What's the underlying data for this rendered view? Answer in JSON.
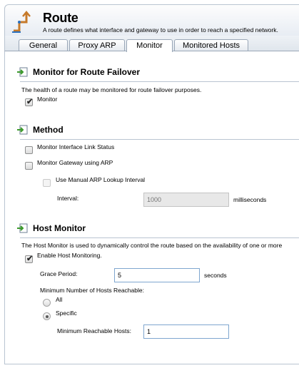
{
  "header": {
    "title": "Route",
    "subtitle": "A route defines what interface and gateway to use in order to reach a specified network."
  },
  "tabs": [
    {
      "label": "General"
    },
    {
      "label": "Proxy ARP"
    },
    {
      "label": "Monitor",
      "active": true
    },
    {
      "label": "Monitored Hosts"
    }
  ],
  "sections": {
    "failover": {
      "title": "Monitor for Route Failover",
      "description": "The health of a route may be monitored for route failover purposes.",
      "monitor_label": "Monitor",
      "monitor_checked": true
    },
    "method": {
      "title": "Method",
      "link_status_label": "Monitor Interface Link Status",
      "link_status_checked": false,
      "gateway_arp_label": "Monitor Gateway using ARP",
      "gateway_arp_checked": false,
      "manual_arp_label": "Use Manual ARP Lookup Interval",
      "manual_arp_checked": false,
      "interval_label": "Interval:",
      "interval_value": "1000",
      "interval_unit": "milliseconds"
    },
    "host_monitor": {
      "title": "Host Monitor",
      "description": "The Host Monitor is used to dynamically control the route based on the availability of one or more",
      "enable_label": "Enable Host Monitoring.",
      "enable_checked": true,
      "grace_label": "Grace Period:",
      "grace_value": "5",
      "grace_unit": "seconds",
      "min_hosts_label": "Minimum Number of Hosts Reachable:",
      "option_all": "All",
      "option_specific": "Specific",
      "selected_option": "Specific",
      "min_reachable_label": "Minimum Reachable Hosts:",
      "min_reachable_value": "1"
    }
  },
  "colors": {
    "section_icon_green": "#3c9a2c",
    "input_border": "#7fa6cf",
    "header_border": "#b9c4d1"
  },
  "icons": {
    "header": "route-icon",
    "section": "arrow-into-box-icon"
  }
}
